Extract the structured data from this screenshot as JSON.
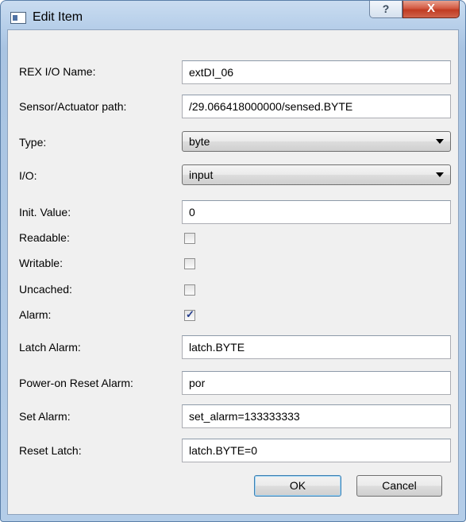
{
  "window": {
    "title": "Edit Item"
  },
  "titlebar_buttons": {
    "help": "?",
    "close": "X"
  },
  "fields": {
    "rex_io_name": {
      "label": "REX I/O Name:",
      "value": "extDI_06"
    },
    "sensor_path": {
      "label": "Sensor/Actuator path:",
      "value": "/29.066418000000/sensed.BYTE"
    },
    "type": {
      "label": "Type:",
      "value": "byte"
    },
    "io": {
      "label": "I/O:",
      "value": "input"
    },
    "init_value": {
      "label": "Init. Value:",
      "value": "0"
    },
    "readable": {
      "label": "Readable:",
      "checked": false
    },
    "writable": {
      "label": "Writable:",
      "checked": false
    },
    "uncached": {
      "label": "Uncached:",
      "checked": false
    },
    "alarm": {
      "label": "Alarm:",
      "checked": true,
      "mark": "✓"
    },
    "latch_alarm": {
      "label": "Latch Alarm:",
      "value": "latch.BYTE"
    },
    "power_on_reset_alarm": {
      "label": "Power-on Reset Alarm:",
      "value": "por"
    },
    "set_alarm": {
      "label": "Set Alarm:",
      "value": "set_alarm=133333333"
    },
    "reset_latch": {
      "label": "Reset Latch:",
      "value": "latch.BYTE=0"
    }
  },
  "buttons": {
    "ok": "OK",
    "cancel": "Cancel"
  },
  "colors": {
    "window_frame": "#b8d0ea",
    "close_button": "#c9412a",
    "dialog_bg": "#f0f0f0",
    "default_button_border": "#3c7fb1"
  }
}
